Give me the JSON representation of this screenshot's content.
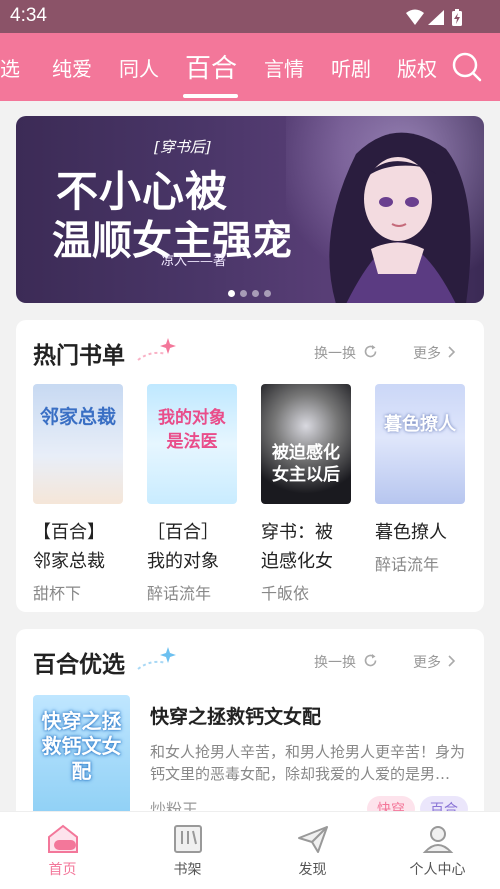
{
  "status_bar": {
    "time": "4:34"
  },
  "top_tabs": [
    {
      "label": "选"
    },
    {
      "label": "纯爱"
    },
    {
      "label": "同人"
    },
    {
      "label": "百合",
      "active": true
    },
    {
      "label": "言情"
    },
    {
      "label": "听剧"
    },
    {
      "label": "版权"
    }
  ],
  "banner": {
    "subtitle": "[穿书后]",
    "title_line1": "不小心被",
    "title_line2": "温顺女主强宠",
    "author": "凉入——著",
    "page_count": 4,
    "current_page": 1
  },
  "hot_books": {
    "title": "热门书单",
    "refresh_label": "换一换",
    "more_label": "更多",
    "books": [
      {
        "title_line1": "【百合】",
        "title_line2": "邻家总裁",
        "author": "甜杯下",
        "cover_text": "邻家总裁"
      },
      {
        "title_line1": "［百合］",
        "title_line2": "我的对象",
        "author": "醉话流年",
        "cover_text": "我的对象是法医"
      },
      {
        "title_line1": "穿书：被",
        "title_line2": "迫感化女",
        "author": "千皈依",
        "cover_text": "被迫感化女主以后"
      },
      {
        "title_line1": "暮色撩人",
        "title_line2": "",
        "author": "醉话流年",
        "cover_text": "暮色撩人"
      }
    ]
  },
  "picks": {
    "title": "百合优选",
    "refresh_label": "换一换",
    "more_label": "更多",
    "item": {
      "title": "快穿之拯救钙文女配",
      "desc": "和女人抢男人辛苦，和男人抢男人更辛苦！身为钙文里的恶毒女配，除却我爱的人爱的是男…",
      "author": "炒粉王",
      "cover_text": "快穿之拯救钙文女配",
      "tags": [
        "快穿",
        "百合"
      ]
    }
  },
  "bottom_nav": [
    {
      "label": "首页",
      "icon": "home-icon",
      "active": true
    },
    {
      "label": "书架",
      "icon": "bookshelf-icon"
    },
    {
      "label": "发现",
      "icon": "discover-icon"
    },
    {
      "label": "个人中心",
      "icon": "profile-icon"
    }
  ],
  "colors": {
    "accent": "#f3779a",
    "status_bar": "#8b5368"
  }
}
